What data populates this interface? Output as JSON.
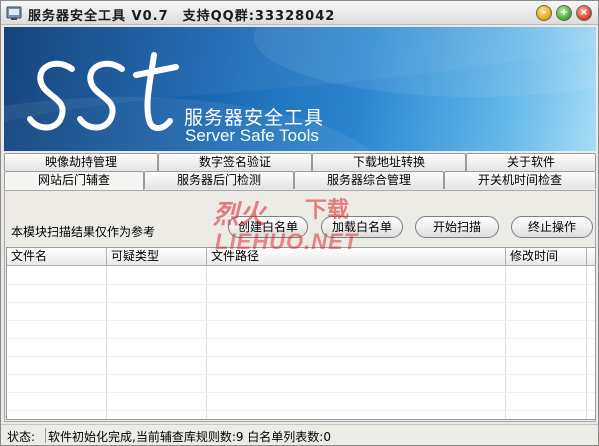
{
  "window": {
    "title": "服务器安全工具 V0.7",
    "qq": "支持QQ群:33328042",
    "controls": [
      "minimize",
      "maximize",
      "close"
    ]
  },
  "banner": {
    "logo": "SST",
    "title_cn": "服务器安全工具",
    "title_en": "Server Safe Tools"
  },
  "tabs": {
    "row1": [
      "映像劫持管理",
      "数字签名验证",
      "下载地址转换",
      "关于软件"
    ],
    "row2": [
      "网站后门辅查",
      "服务器后门检测",
      "服务器综合管理",
      "开关机时间检查"
    ],
    "active": "网站后门辅查"
  },
  "panel": {
    "hint": "本模块扫描结果仅作为参考",
    "buttons": {
      "create_whitelist": "创建白名单",
      "load_whitelist": "加载白名单",
      "start_scan": "开始扫描",
      "stop": "终止操作"
    }
  },
  "table": {
    "columns": [
      "文件名",
      "可疑类型",
      "文件路径",
      "修改时间"
    ],
    "rows": []
  },
  "status": {
    "label": "状态:",
    "text": "软件初始化完成,当前辅查库规则数:9 白名单列表数:0"
  },
  "watermark": {
    "cn": "烈火下载",
    "en": "LIEHUO.NET"
  },
  "colors": {
    "banner_dark": "#0a3b76",
    "banner_light": "#a7dcf7",
    "watermark_red": "#d9232b"
  }
}
